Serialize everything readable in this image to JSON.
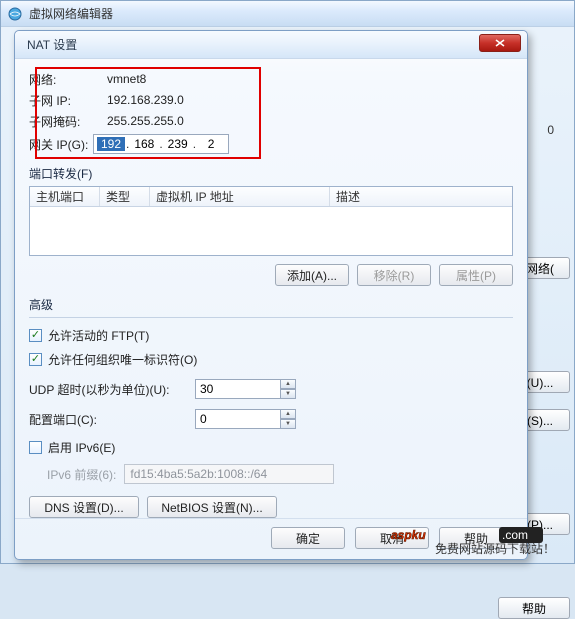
{
  "parent": {
    "title": "虚拟网络编辑器"
  },
  "side": {
    "text0": "0",
    "zero": ".0",
    "btn_remove": "除网络(",
    "btn_u": "置(U)...",
    "btn_s": "置(S)...",
    "btn_p": "置(P)...",
    "help": "帮助"
  },
  "dialog": {
    "title": "NAT 设置",
    "close": "✕",
    "info": {
      "net_label": "网络:",
      "net_value": "vmnet8",
      "subnet_label": "子网 IP:",
      "subnet_value": "192.168.239.0",
      "mask_label": "子网掩码:",
      "mask_value": "255.255.255.0",
      "gw_label": "网关 IP(G):",
      "gw_oct1": "192",
      "gw_oct2": "168",
      "gw_oct3": "239",
      "gw_oct4": "2"
    },
    "port_forward": {
      "title": "端口转发(F)",
      "col_host": "主机端口",
      "col_type": "类型",
      "col_vm": "虚拟机 IP 地址",
      "col_desc": "描述",
      "btn_add": "添加(A)...",
      "btn_remove": "移除(R)",
      "btn_prop": "属性(P)"
    },
    "advanced": {
      "title": "高级",
      "ftp_label": "允许活动的 FTP(T)",
      "org_label": "允许任何组织唯一标识符(O)",
      "udp_label": "UDP 超时(以秒为单位)(U):",
      "udp_value": "30",
      "config_port_label": "配置端口(C):",
      "config_port_value": "0",
      "ipv6_label": "启用 IPv6(E)",
      "prefix_label": "IPv6 前缀(6):",
      "prefix_value": "fd15:4ba5:5a2b:1008::/64"
    },
    "dns_btn": "DNS 设置(D)...",
    "netbios_btn": "NetBIOS 设置(N)...",
    "ok": "确定",
    "cancel": "取消",
    "help": "帮助"
  },
  "watermark": {
    "text": "aspku",
    "dotcom": ".com",
    "sub": "免费网站源码下载站！"
  }
}
